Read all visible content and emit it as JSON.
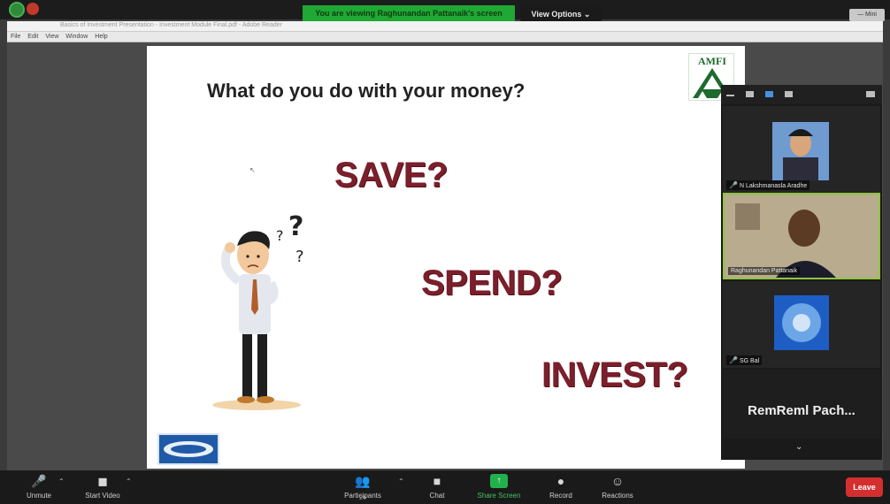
{
  "banner": {
    "viewing_text": "You are viewing Raghunandan Pattanaik's screen",
    "view_options": "View Options ⌄",
    "minimize_label": "— Mini"
  },
  "shared_window": {
    "title": "Basics of Investment Presentation - Investment Module Final.pdf - Adobe Reader",
    "menu": [
      "File",
      "Edit",
      "View",
      "Window",
      "Help"
    ]
  },
  "slide": {
    "title": "What do you do with your money?",
    "words": [
      "SAVE?",
      "SPEND?",
      "INVEST?"
    ],
    "logo_text": "AMFI"
  },
  "panel": {
    "participants": [
      {
        "name": "N Lakshmanasla Aradhe",
        "muted": true
      },
      {
        "name": "Raghunandan Pattanaik",
        "muted": false
      },
      {
        "name": "SG Bal",
        "muted": true
      }
    ],
    "active_speaker_text": "RemReml  Pach..."
  },
  "toolbar": {
    "unmute": "Unmute",
    "start_video": "Start Video",
    "participants": "Participants",
    "participants_count": "24",
    "chat": "Chat",
    "share_screen": "Share Screen",
    "record": "Record",
    "reactions": "Reactions",
    "leave": "Leave"
  },
  "colors": {
    "accent_green": "#1fa834",
    "leave_red": "#d32f2f",
    "slide_word": "#7a1f2b"
  }
}
